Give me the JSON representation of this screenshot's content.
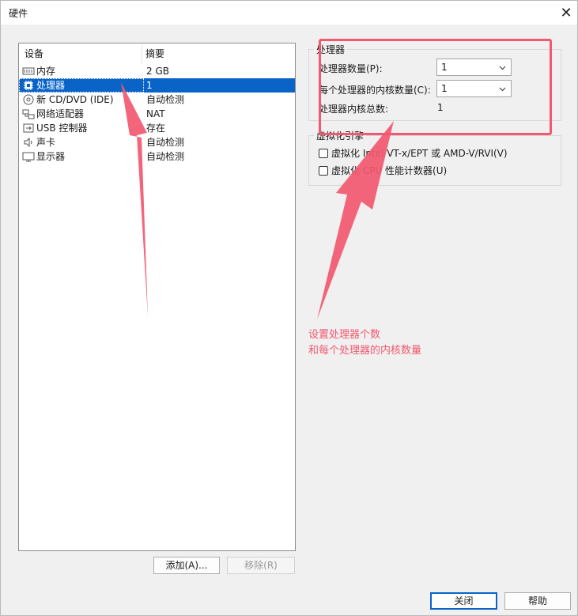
{
  "window": {
    "title": "硬件",
    "close_glyph": "✕"
  },
  "device_list": {
    "headers": [
      "设备",
      "摘要"
    ],
    "rows": [
      {
        "icon": "memory-icon",
        "device": "内存",
        "summary": "2 GB",
        "selected": false
      },
      {
        "icon": "cpu-icon",
        "device": "处理器",
        "summary": "1",
        "selected": true
      },
      {
        "icon": "cd-icon",
        "device": "新 CD/DVD (IDE)",
        "summary": "自动检测",
        "selected": false
      },
      {
        "icon": "network-icon",
        "device": "网络适配器",
        "summary": "NAT",
        "selected": false
      },
      {
        "icon": "usb-icon",
        "device": "USB 控制器",
        "summary": "存在",
        "selected": false
      },
      {
        "icon": "speaker-icon",
        "device": "声卡",
        "summary": "自动检测",
        "selected": false
      },
      {
        "icon": "monitor-icon",
        "device": "显示器",
        "summary": "自动检测",
        "selected": false
      }
    ]
  },
  "buttons": {
    "add": "添加(A)...",
    "remove": "移除(R)",
    "close": "关闭",
    "help": "帮助"
  },
  "processors": {
    "group_title": "处理器",
    "count_label": "处理器数量(P):",
    "count_value": "1",
    "cores_label": "每个处理器的内核数量(C):",
    "cores_value": "1",
    "total_label": "处理器内核总数:",
    "total_value": "1"
  },
  "virtualization": {
    "group_title": "虚拟化引擎",
    "option1": "虚拟化 Intel VT-x/EPT 或 AMD-V/RVI(V)",
    "option2": "虚拟化 CPU 性能计数器(U)"
  },
  "annotation": {
    "line1": "设置处理器个数",
    "line2": "和每个处理器的内核数量",
    "color": "#f2586f"
  },
  "colors": {
    "selection": "#0a64c8",
    "accent": "#0a64c8"
  }
}
